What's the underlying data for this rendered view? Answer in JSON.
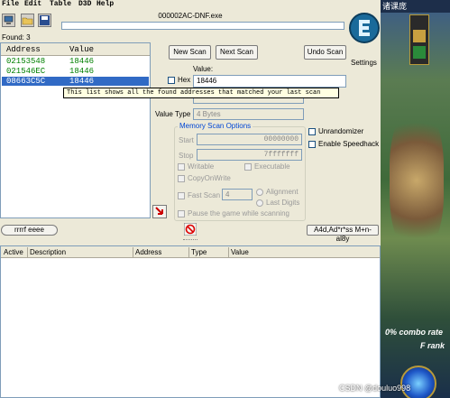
{
  "menu": [
    "File",
    "Edit",
    "Table",
    "D3D",
    "Help"
  ],
  "window_title": "000002AC-DNF.exe",
  "found_label": "Found: 3",
  "found_list": {
    "columns": [
      "Address",
      "Value"
    ],
    "rows": [
      {
        "address": "02153548",
        "value": "18446"
      },
      {
        "address": "021546EC",
        "value": "18446"
      },
      {
        "address": "08663C5C",
        "value": "18446"
      }
    ],
    "selected_index": 2
  },
  "buttons": {
    "new_scan": "New Scan",
    "next_scan": "Next Scan",
    "undo_scan": "Undo Scan",
    "settings": "Settings",
    "memory_view": "rrrrf eeee",
    "add_address": "A4d,Ad*r*ss M+n-al8y"
  },
  "value_label": "Value:",
  "hex_label": "Hex",
  "value_input": "18446",
  "tooltip": "This list shows all the found addresses that matched your last scan",
  "value_type": {
    "label": "Value Type",
    "selected": "4 Bytes"
  },
  "memory_options": {
    "title": "Memory Scan Options",
    "start_label": "Start",
    "start_value": "00000000",
    "stop_label": "Stop",
    "stop_value": "7fffffff",
    "writable": "Writable",
    "executable": "Executable",
    "copy_on_write": "CopyOnWrite",
    "fast_scan": "Fast Scan",
    "fast_scan_value": "4",
    "alignment": "Alignment",
    "last_digits": "Last Digits",
    "pause_game": "Pause the game while scanning"
  },
  "unrandomizer": "Unrandomizer",
  "enable_speedhack": "Enable Speedhack",
  "address_list_columns": [
    "Active",
    "Description",
    "Address",
    "Type",
    "Value"
  ],
  "game": {
    "title_fragment": "诸课庞",
    "combo_text": "0% combo rate",
    "rank_text": "F rank"
  },
  "watermark": "CSDN @douluo998",
  "colors": {
    "selection": "#316ac5",
    "found_text": "#008000",
    "group_title": "#0046d5"
  }
}
